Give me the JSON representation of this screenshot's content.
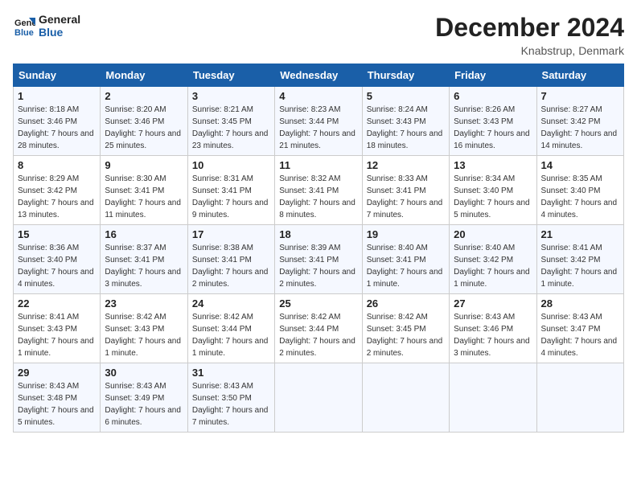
{
  "header": {
    "logo_line1": "General",
    "logo_line2": "Blue",
    "month_title": "December 2024",
    "location": "Knabstrup, Denmark"
  },
  "weekdays": [
    "Sunday",
    "Monday",
    "Tuesday",
    "Wednesday",
    "Thursday",
    "Friday",
    "Saturday"
  ],
  "weeks": [
    [
      {
        "day": "1",
        "sunrise": "Sunrise: 8:18 AM",
        "sunset": "Sunset: 3:46 PM",
        "daylight": "Daylight: 7 hours and 28 minutes."
      },
      {
        "day": "2",
        "sunrise": "Sunrise: 8:20 AM",
        "sunset": "Sunset: 3:46 PM",
        "daylight": "Daylight: 7 hours and 25 minutes."
      },
      {
        "day": "3",
        "sunrise": "Sunrise: 8:21 AM",
        "sunset": "Sunset: 3:45 PM",
        "daylight": "Daylight: 7 hours and 23 minutes."
      },
      {
        "day": "4",
        "sunrise": "Sunrise: 8:23 AM",
        "sunset": "Sunset: 3:44 PM",
        "daylight": "Daylight: 7 hours and 21 minutes."
      },
      {
        "day": "5",
        "sunrise": "Sunrise: 8:24 AM",
        "sunset": "Sunset: 3:43 PM",
        "daylight": "Daylight: 7 hours and 18 minutes."
      },
      {
        "day": "6",
        "sunrise": "Sunrise: 8:26 AM",
        "sunset": "Sunset: 3:43 PM",
        "daylight": "Daylight: 7 hours and 16 minutes."
      },
      {
        "day": "7",
        "sunrise": "Sunrise: 8:27 AM",
        "sunset": "Sunset: 3:42 PM",
        "daylight": "Daylight: 7 hours and 14 minutes."
      }
    ],
    [
      {
        "day": "8",
        "sunrise": "Sunrise: 8:29 AM",
        "sunset": "Sunset: 3:42 PM",
        "daylight": "Daylight: 7 hours and 13 minutes."
      },
      {
        "day": "9",
        "sunrise": "Sunrise: 8:30 AM",
        "sunset": "Sunset: 3:41 PM",
        "daylight": "Daylight: 7 hours and 11 minutes."
      },
      {
        "day": "10",
        "sunrise": "Sunrise: 8:31 AM",
        "sunset": "Sunset: 3:41 PM",
        "daylight": "Daylight: 7 hours and 9 minutes."
      },
      {
        "day": "11",
        "sunrise": "Sunrise: 8:32 AM",
        "sunset": "Sunset: 3:41 PM",
        "daylight": "Daylight: 7 hours and 8 minutes."
      },
      {
        "day": "12",
        "sunrise": "Sunrise: 8:33 AM",
        "sunset": "Sunset: 3:41 PM",
        "daylight": "Daylight: 7 hours and 7 minutes."
      },
      {
        "day": "13",
        "sunrise": "Sunrise: 8:34 AM",
        "sunset": "Sunset: 3:40 PM",
        "daylight": "Daylight: 7 hours and 5 minutes."
      },
      {
        "day": "14",
        "sunrise": "Sunrise: 8:35 AM",
        "sunset": "Sunset: 3:40 PM",
        "daylight": "Daylight: 7 hours and 4 minutes."
      }
    ],
    [
      {
        "day": "15",
        "sunrise": "Sunrise: 8:36 AM",
        "sunset": "Sunset: 3:40 PM",
        "daylight": "Daylight: 7 hours and 4 minutes."
      },
      {
        "day": "16",
        "sunrise": "Sunrise: 8:37 AM",
        "sunset": "Sunset: 3:41 PM",
        "daylight": "Daylight: 7 hours and 3 minutes."
      },
      {
        "day": "17",
        "sunrise": "Sunrise: 8:38 AM",
        "sunset": "Sunset: 3:41 PM",
        "daylight": "Daylight: 7 hours and 2 minutes."
      },
      {
        "day": "18",
        "sunrise": "Sunrise: 8:39 AM",
        "sunset": "Sunset: 3:41 PM",
        "daylight": "Daylight: 7 hours and 2 minutes."
      },
      {
        "day": "19",
        "sunrise": "Sunrise: 8:40 AM",
        "sunset": "Sunset: 3:41 PM",
        "daylight": "Daylight: 7 hours and 1 minute."
      },
      {
        "day": "20",
        "sunrise": "Sunrise: 8:40 AM",
        "sunset": "Sunset: 3:42 PM",
        "daylight": "Daylight: 7 hours and 1 minute."
      },
      {
        "day": "21",
        "sunrise": "Sunrise: 8:41 AM",
        "sunset": "Sunset: 3:42 PM",
        "daylight": "Daylight: 7 hours and 1 minute."
      }
    ],
    [
      {
        "day": "22",
        "sunrise": "Sunrise: 8:41 AM",
        "sunset": "Sunset: 3:43 PM",
        "daylight": "Daylight: 7 hours and 1 minute."
      },
      {
        "day": "23",
        "sunrise": "Sunrise: 8:42 AM",
        "sunset": "Sunset: 3:43 PM",
        "daylight": "Daylight: 7 hours and 1 minute."
      },
      {
        "day": "24",
        "sunrise": "Sunrise: 8:42 AM",
        "sunset": "Sunset: 3:44 PM",
        "daylight": "Daylight: 7 hours and 1 minute."
      },
      {
        "day": "25",
        "sunrise": "Sunrise: 8:42 AM",
        "sunset": "Sunset: 3:44 PM",
        "daylight": "Daylight: 7 hours and 2 minutes."
      },
      {
        "day": "26",
        "sunrise": "Sunrise: 8:42 AM",
        "sunset": "Sunset: 3:45 PM",
        "daylight": "Daylight: 7 hours and 2 minutes."
      },
      {
        "day": "27",
        "sunrise": "Sunrise: 8:43 AM",
        "sunset": "Sunset: 3:46 PM",
        "daylight": "Daylight: 7 hours and 3 minutes."
      },
      {
        "day": "28",
        "sunrise": "Sunrise: 8:43 AM",
        "sunset": "Sunset: 3:47 PM",
        "daylight": "Daylight: 7 hours and 4 minutes."
      }
    ],
    [
      {
        "day": "29",
        "sunrise": "Sunrise: 8:43 AM",
        "sunset": "Sunset: 3:48 PM",
        "daylight": "Daylight: 7 hours and 5 minutes."
      },
      {
        "day": "30",
        "sunrise": "Sunrise: 8:43 AM",
        "sunset": "Sunset: 3:49 PM",
        "daylight": "Daylight: 7 hours and 6 minutes."
      },
      {
        "day": "31",
        "sunrise": "Sunrise: 8:43 AM",
        "sunset": "Sunset: 3:50 PM",
        "daylight": "Daylight: 7 hours and 7 minutes."
      },
      null,
      null,
      null,
      null
    ]
  ]
}
